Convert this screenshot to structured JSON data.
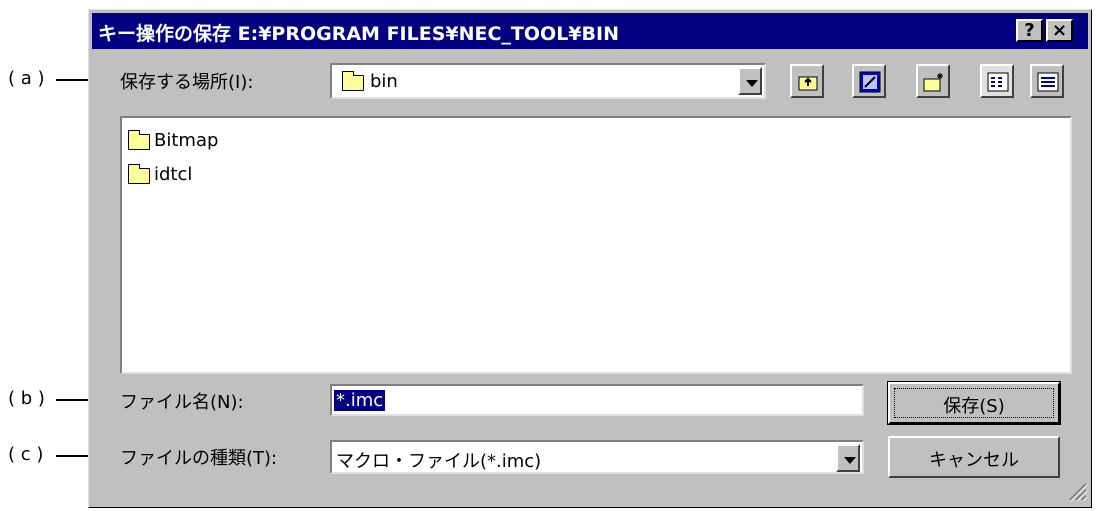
{
  "window": {
    "title": "キー操作の保存  E:¥PROGRAM FILES¥NEC_TOOL¥BIN",
    "help_button": "?",
    "close_button": "×"
  },
  "location": {
    "label": "保存する場所(I):",
    "value": "bin"
  },
  "toolbar": {
    "icons": [
      "up-one-level-icon",
      "desktop-icon",
      "new-folder-icon",
      "list-view-icon",
      "details-view-icon"
    ]
  },
  "files": [
    {
      "name": "Bitmap",
      "icon": "folder-icon"
    },
    {
      "name": "idtcl",
      "icon": "folder-icon"
    }
  ],
  "filename": {
    "label": "ファイル名(N):",
    "value": "*.imc"
  },
  "filetype": {
    "label": "ファイルの種類(T):",
    "value": "マクロ・ファイル(*.imc)"
  },
  "buttons": {
    "save": "保存(S)",
    "cancel": "キャンセル"
  },
  "callouts": {
    "a": "( a )",
    "b": "( b )",
    "c": "( c )"
  },
  "colors": {
    "titlebar": "#000080",
    "dialog_bg": "#c0c0c0",
    "selection": "#000080"
  }
}
